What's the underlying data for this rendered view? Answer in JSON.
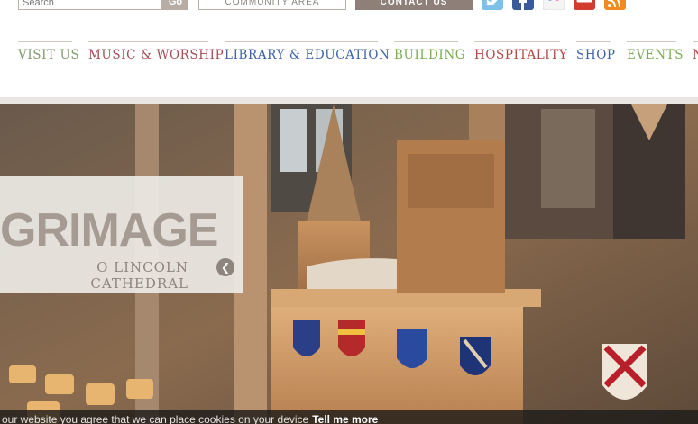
{
  "search": {
    "placeholder": "Search",
    "go_label": "Go"
  },
  "header_buttons": {
    "community": "COMMUNITY AREA",
    "contact": "CONTACT US"
  },
  "social": [
    {
      "icon": "twitter-icon",
      "color": "#6fb9e8"
    },
    {
      "icon": "facebook-icon",
      "color": "#3b5b98"
    },
    {
      "icon": "flickr-icon",
      "color": "#ff0084"
    },
    {
      "icon": "youtube-icon",
      "color": "#cc2222"
    },
    {
      "icon": "rss-icon",
      "color": "#f08a22"
    }
  ],
  "nav": [
    {
      "label": "Visit Us",
      "color": "#7c9a6a"
    },
    {
      "label": "Music & Worship",
      "color": "#a44a55"
    },
    {
      "label": "Library & Education",
      "color": "#3f62a7"
    },
    {
      "label": "Building",
      "color": "#7aaa52"
    },
    {
      "label": "Hospitality",
      "color": "#b0483f"
    },
    {
      "label": "Shop",
      "color": "#3f62a7"
    },
    {
      "label": "Events",
      "color": "#7aaa52"
    },
    {
      "label": "N",
      "color": "#b0483f"
    }
  ],
  "hero": {
    "title": "GRIMAGE",
    "subtitle": "O LINCOLN CATHEDRAL",
    "prev_glyph": "❮"
  },
  "cookie": {
    "text": "our website you agree that we can place cookies on your device",
    "link": "Tell me more"
  }
}
